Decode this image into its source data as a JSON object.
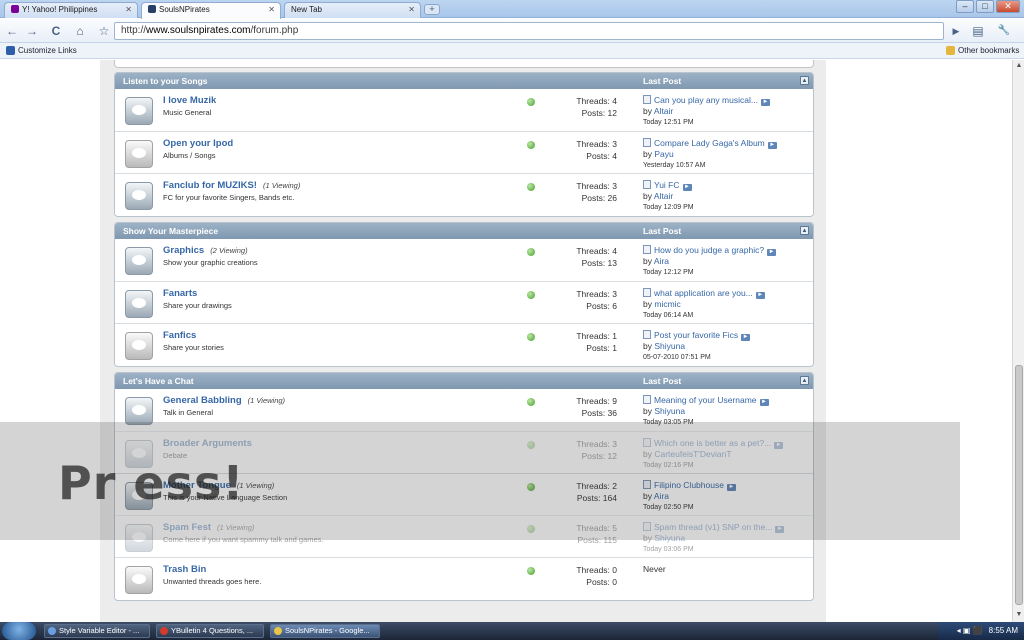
{
  "browser": {
    "tabs": [
      {
        "label": "Y! Yahoo! Philippines",
        "active": false,
        "favicon_color": "#7b0099"
      },
      {
        "label": "SoulsNPirates",
        "active": true,
        "favicon_color": "#2a3f66"
      },
      {
        "label": "New Tab",
        "active": false,
        "favicon_color": "#d0dbe8"
      }
    ],
    "new_tab_symbol": "+",
    "window_buttons": [
      "–",
      "□",
      "✕"
    ],
    "nav": {
      "back": "←",
      "forward": "→",
      "reload": "C",
      "home": "⌂",
      "star": "☆",
      "go": "▶",
      "page": "▤",
      "tools": "🔧"
    },
    "address": {
      "prefix": "http://",
      "host": "www.soulsnpirates.com",
      "path": "/forum.php"
    },
    "bookmarks": {
      "left": "Customize Links",
      "right": "Other bookmarks"
    }
  },
  "forum": {
    "last_post_header": "Last Post",
    "sections": [
      {
        "title": "Listen to your Songs",
        "forums": [
          {
            "name": "I love Muzik",
            "viewing": "",
            "desc": "Music General",
            "threads": "Threads: 4",
            "posts": "Posts: 12",
            "lp_title": "Can you play any musical...",
            "lp_user": "Altair",
            "lp_time": "Today 12:51 PM"
          },
          {
            "name": "Open your Ipod",
            "viewing": "",
            "desc": "Albums / Songs",
            "threads": "Threads: 3",
            "posts": "Posts: 4",
            "lp_title": "Compare Lady Gaga's Album",
            "lp_user": "Payu",
            "lp_time": "Yesterday 10:57 AM"
          },
          {
            "name": "Fanclub for MUZIKS!",
            "viewing": "(1 Viewing)",
            "desc": "FC for your favorite Singers, Bands etc.",
            "threads": "Threads: 3",
            "posts": "Posts: 26",
            "lp_title": "Yui FC",
            "lp_user": "Altair",
            "lp_time": "Today 12:09 PM"
          }
        ]
      },
      {
        "title": "Show Your Masterpiece",
        "forums": [
          {
            "name": "Graphics",
            "viewing": "(2 Viewing)",
            "desc": "Show your graphic creations",
            "threads": "Threads: 4",
            "posts": "Posts: 13",
            "lp_title": "How do you judge a graphic?",
            "lp_user": "Aira",
            "lp_time": "Today 12:12 PM"
          },
          {
            "name": "Fanarts",
            "viewing": "",
            "desc": "Share your drawings",
            "threads": "Threads: 3",
            "posts": "Posts: 6",
            "lp_title": "what application are you...",
            "lp_user": "micmic",
            "lp_time": "Today 06:14 AM"
          },
          {
            "name": "Fanfics",
            "viewing": "",
            "desc": "Share your stories",
            "threads": "Threads: 1",
            "posts": "Posts: 1",
            "lp_title": "Post your favorite Fics",
            "lp_user": "Shiyuna",
            "lp_time": "05-07-2010 07:51 PM"
          }
        ]
      },
      {
        "title": "Let's Have a Chat",
        "forums": [
          {
            "name": "General Babbling",
            "viewing": "(1 Viewing)",
            "desc": "Talk in General",
            "threads": "Threads: 9",
            "posts": "Posts: 36",
            "lp_title": "Meaning of your Username",
            "lp_user": "Shiyuna",
            "lp_time": "Today 03:05 PM"
          },
          {
            "name": "Broader Arguments",
            "viewing": "",
            "desc": "Debate",
            "threads": "Threads: 3",
            "posts": "Posts: 12",
            "lp_title": "Which one is better as a pet?...",
            "lp_user": "CarteufeisT'DevianT",
            "lp_time": "Today 02:16 PM"
          },
          {
            "name": "Mother Tongue",
            "viewing": "(1 Viewing)",
            "desc": "This is your Native Language Section",
            "threads": "Threads: 2",
            "posts": "Posts: 164",
            "lp_title": "Filipino Clubhouse",
            "lp_user": "Aira",
            "lp_time": "Today 02:50 PM"
          },
          {
            "name": "Spam Fest",
            "viewing": "(1 Viewing)",
            "desc": "Come here if you want spammy talk and games.",
            "threads": "Threads: 5",
            "posts": "Posts: 115",
            "lp_title": "Spam thread (v1) SNP on the...",
            "lp_user": "Shiyuna",
            "lp_time": "Today 03:06 PM"
          },
          {
            "name": "Trash Bin",
            "viewing": "",
            "desc": "Unwanted threads goes here.",
            "threads": "Threads: 0",
            "posts": "Posts: 0",
            "lp_title": "",
            "lp_user": "",
            "lp_time": "",
            "lp_never": "Never"
          }
        ]
      }
    ],
    "by_word": "by"
  },
  "overlay": {
    "text": "Pr                              ess!"
  },
  "taskbar": {
    "tasks": [
      {
        "label": "Style Variable Editor - ...",
        "active": false
      },
      {
        "label": "YBulletin 4 Questions, ...",
        "active": false
      },
      {
        "label": "SoulsNPirates - Google...",
        "active": true
      }
    ],
    "clock": "8:55 AM"
  }
}
